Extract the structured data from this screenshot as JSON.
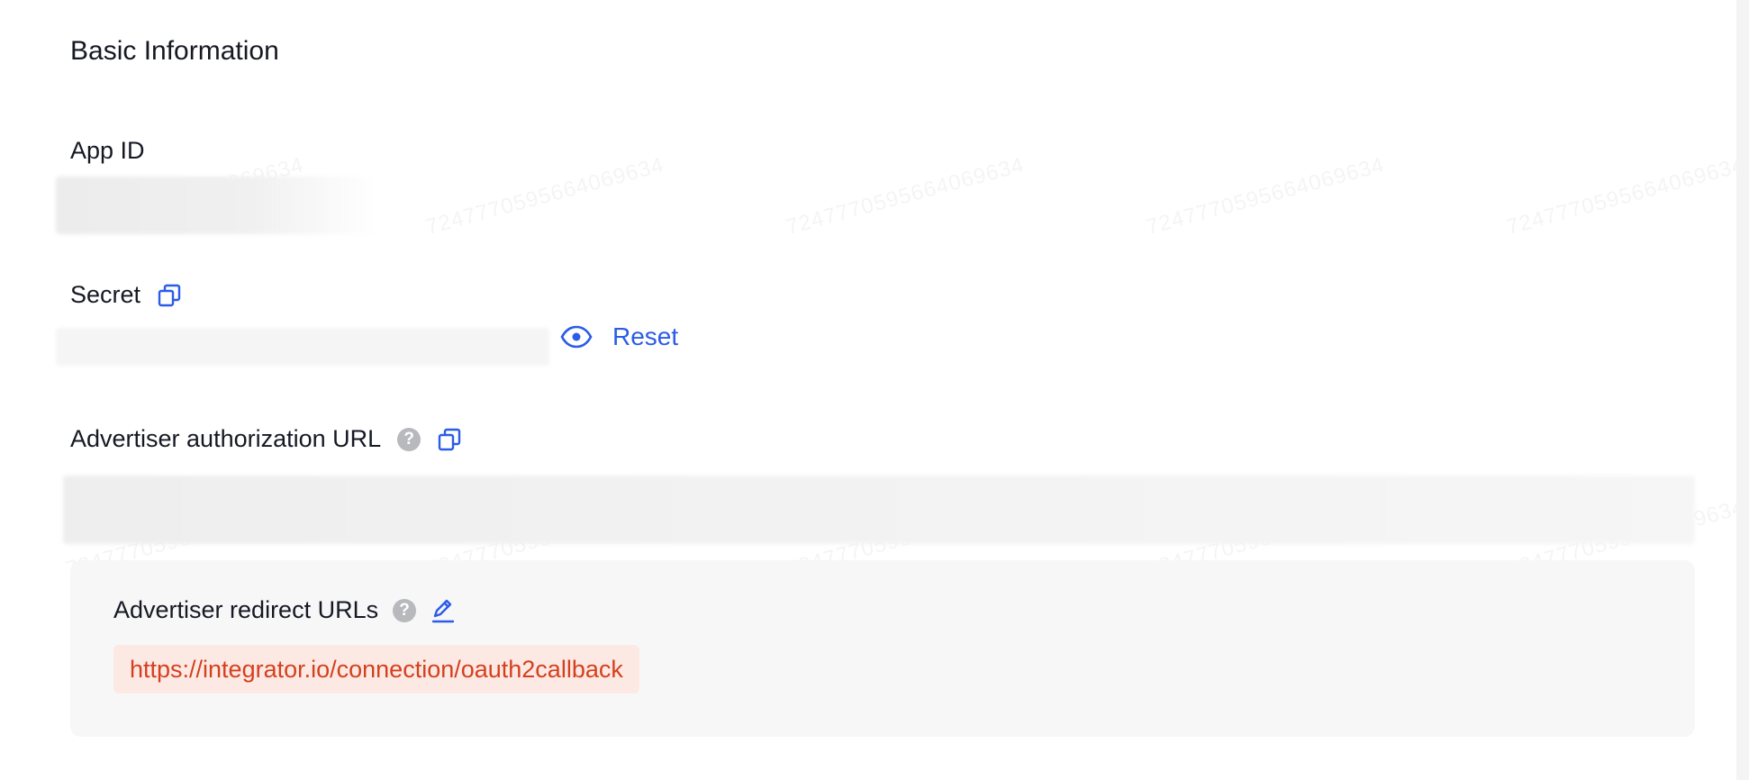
{
  "section": {
    "title": "Basic Information"
  },
  "fields": {
    "app_id": {
      "label": "App ID"
    },
    "secret": {
      "label": "Secret",
      "reset_label": "Reset"
    },
    "auth_url": {
      "label": "Advertiser authorization URL"
    },
    "redirect_urls": {
      "label": "Advertiser redirect URLs",
      "items": [
        "https://integrator.io/connection/oauth2callback"
      ]
    }
  },
  "watermark": {
    "text": "7247770595664069634"
  },
  "icons": {
    "copy": "copy-icon",
    "eye": "eye-icon",
    "help": "help-icon",
    "edit": "edit-icon"
  },
  "colors": {
    "accent": "#2b5ce6",
    "url_text": "#d4401e",
    "url_bg": "#fde9e4",
    "panel_bg": "#f7f7f8",
    "help_bg": "#b8b9bd"
  }
}
